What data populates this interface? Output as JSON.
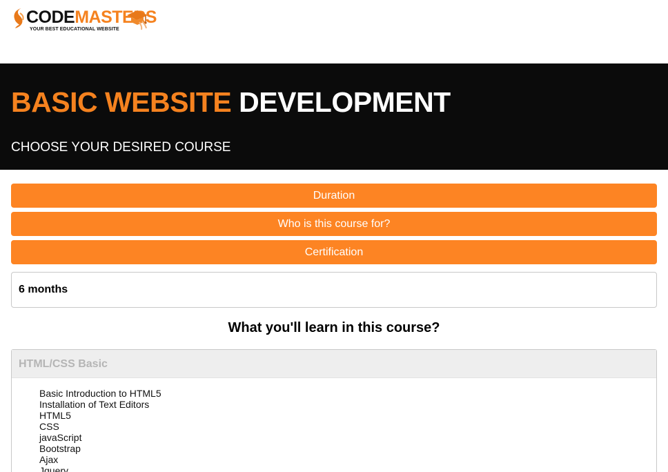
{
  "brand": {
    "name_part1": "CODE",
    "name_part2": "MASTERS",
    "tagline": "YOUR BEST EDUCATIONAL WEBSITE",
    "accent_color": "#f5821f"
  },
  "hero": {
    "title_orange": "BASIC WEBSITE ",
    "title_white": "DEVELOPMENT",
    "subtitle": "CHOOSE YOUR DESIRED COURSE",
    "background": "#0b0b0b"
  },
  "accordion": {
    "buttons": [
      {
        "label": "Duration"
      },
      {
        "label": "Who is this course for?"
      },
      {
        "label": "Certification"
      }
    ],
    "button_color": "#fd8423",
    "open_panel_text": "6 months"
  },
  "learn": {
    "heading": "What you'll learn in this course?",
    "card_title": "HTML/CSS Basic",
    "topics": [
      "Basic Introduction to HTML5",
      "Installation of Text Editors",
      "HTML5",
      "CSS",
      "javaScript",
      "Bootstrap",
      "Ajax",
      "Jquery"
    ]
  }
}
